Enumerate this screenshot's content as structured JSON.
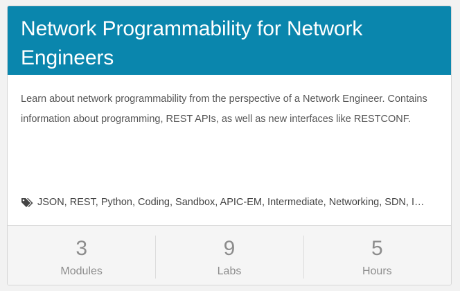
{
  "card": {
    "title": "Network Programmability for Network Engineers",
    "description": "Learn about network programmability from the perspective of a Network Engineer. Contains information about programming, REST APIs, as well as new interfaces like RESTCONF.",
    "tags_icon": "tags-icon",
    "tags_text": "JSON, REST, Python, Coding, Sandbox, APIC-EM, Intermediate, Networking, SDN, I…",
    "stats": [
      {
        "value": "3",
        "label": "Modules"
      },
      {
        "value": "9",
        "label": "Labs"
      },
      {
        "value": "5",
        "label": "Hours"
      }
    ]
  },
  "colors": {
    "header_background": "#0a86ad",
    "header_text": "#ffffff",
    "body_text": "#555555",
    "footer_background": "#f5f5f5",
    "stat_text": "#8c8c8c"
  }
}
